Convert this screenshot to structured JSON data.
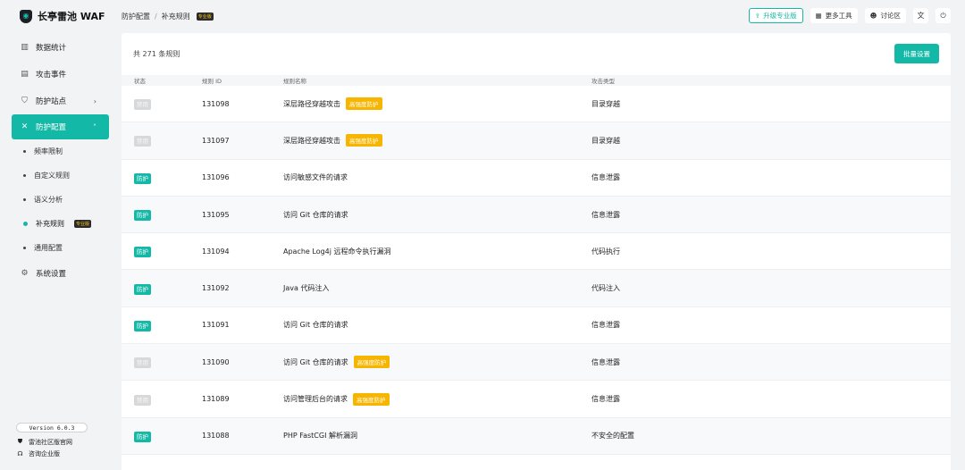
{
  "brand": {
    "name": "长亭雷池 WAF"
  },
  "sidebar": {
    "items": [
      {
        "label": "数据统计",
        "icon": "bar-chart-icon"
      },
      {
        "label": "攻击事件",
        "icon": "document-icon"
      },
      {
        "label": "防护站点",
        "icon": "shield-icon"
      },
      {
        "label": "防护配置",
        "icon": "tools-icon"
      }
    ],
    "sub_items": [
      {
        "label": "频率限制"
      },
      {
        "label": "自定义规则"
      },
      {
        "label": "语义分析"
      },
      {
        "label": "补充规则",
        "badge": "专业版"
      },
      {
        "label": "通用配置"
      }
    ],
    "settings": {
      "label": "系统设置",
      "icon": "gear-icon"
    },
    "version": "Version 6.0.3",
    "links": [
      {
        "label": "雷池社区版官网",
        "icon": "shield-small-icon"
      },
      {
        "label": "咨询企业版",
        "icon": "headset-icon"
      }
    ]
  },
  "header": {
    "breadcrumb": [
      "防护配置",
      "补充规则"
    ],
    "breadcrumb_badge": "专业版",
    "upgrade": "升级专业版",
    "tools": "更多工具",
    "forum": "讨论区"
  },
  "main": {
    "total": "共 271 条规则",
    "batch": "批量设置",
    "columns": {
      "status": "状态",
      "id": "规则 ID",
      "name": "规则名称",
      "type": "攻击类型"
    },
    "rows": [
      {
        "status": "禁用",
        "on": false,
        "id": "131098",
        "name": "深层路径穿越攻击",
        "tag": "高强度防护",
        "type": "目录穿越"
      },
      {
        "status": "禁用",
        "on": false,
        "id": "131097",
        "name": "深层路径穿越攻击",
        "tag": "高强度防护",
        "type": "目录穿越"
      },
      {
        "status": "防护",
        "on": true,
        "id": "131096",
        "name": "访问敏感文件的请求",
        "tag": "",
        "type": "信息泄露"
      },
      {
        "status": "防护",
        "on": true,
        "id": "131095",
        "name": "访问 Git 仓库的请求",
        "tag": "",
        "type": "信息泄露"
      },
      {
        "status": "防护",
        "on": true,
        "id": "131094",
        "name": "Apache Log4j 远程命令执行漏洞",
        "tag": "",
        "type": "代码执行"
      },
      {
        "status": "防护",
        "on": true,
        "id": "131092",
        "name": "Java 代码注入",
        "tag": "",
        "type": "代码注入"
      },
      {
        "status": "防护",
        "on": true,
        "id": "131091",
        "name": "访问 Git 仓库的请求",
        "tag": "",
        "type": "信息泄露"
      },
      {
        "status": "禁用",
        "on": false,
        "id": "131090",
        "name": "访问 Git 仓库的请求",
        "tag": "高强度防护",
        "type": "信息泄露"
      },
      {
        "status": "禁用",
        "on": false,
        "id": "131089",
        "name": "访问管理后台的请求",
        "tag": "高强度防护",
        "type": "信息泄露"
      },
      {
        "status": "防护",
        "on": true,
        "id": "131088",
        "name": "PHP FastCGI 解析漏洞",
        "tag": "",
        "type": "不安全的配置"
      }
    ]
  }
}
